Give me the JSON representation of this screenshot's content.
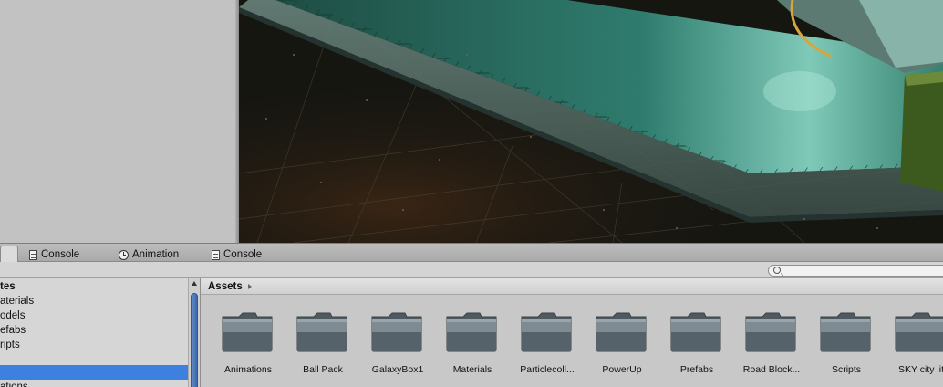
{
  "tabs": [
    {
      "label": "",
      "icon": "document-icon",
      "active": true
    },
    {
      "label": "Console",
      "icon": "console-icon"
    },
    {
      "label": "Animation",
      "icon": "animation-clock-icon"
    },
    {
      "label": "Console",
      "icon": "console-icon"
    }
  ],
  "tree": {
    "items": [
      {
        "label": "tes",
        "bold": true
      },
      {
        "label": "aterials"
      },
      {
        "label": "odels"
      },
      {
        "label": "efabs"
      },
      {
        "label": "ripts"
      },
      {
        "label": ""
      },
      {
        "label": "",
        "selected": true
      },
      {
        "label": "ations"
      }
    ]
  },
  "breadcrumb": {
    "label": "Assets"
  },
  "assets": [
    {
      "label": "Animations"
    },
    {
      "label": "Ball Pack"
    },
    {
      "label": "GalaxyBox1"
    },
    {
      "label": "Materials"
    },
    {
      "label": "Particlecoll..."
    },
    {
      "label": "PowerUp"
    },
    {
      "label": "Prefabs"
    },
    {
      "label": "Road Block..."
    },
    {
      "label": "Scripts"
    },
    {
      "label": "SKY city lit"
    }
  ],
  "colors": {
    "selection": "#3d80df",
    "folder_top": "#7f8b92",
    "folder_body": "#4f5a60",
    "tile": "#2f7c6e"
  }
}
